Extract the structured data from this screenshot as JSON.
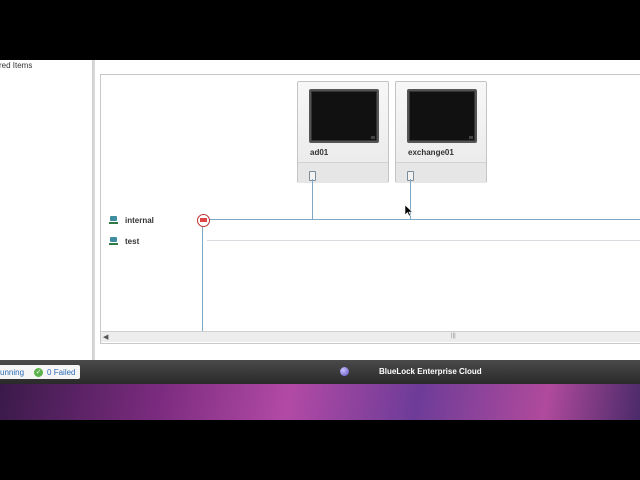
{
  "left_panel": {
    "section_label": "red Items"
  },
  "vms": [
    {
      "name": "ad01"
    },
    {
      "name": "exchange01"
    }
  ],
  "networks": [
    {
      "name": "internal"
    },
    {
      "name": "test"
    }
  ],
  "status_bar": {
    "running_label": "unning",
    "failed_label": "0 Failed",
    "brand_name": "BlueLock Enterprise Cloud"
  },
  "colors": {
    "wire": "#7fa7c6",
    "success": "#5bb24a",
    "link": "#2d6cb8",
    "router": "#d44"
  },
  "icons": [
    "network-icon",
    "router-icon",
    "vm-screen-icon",
    "nic-connector-icon",
    "check-icon",
    "bluelock-logo-icon",
    "mouse-cursor-icon"
  ]
}
